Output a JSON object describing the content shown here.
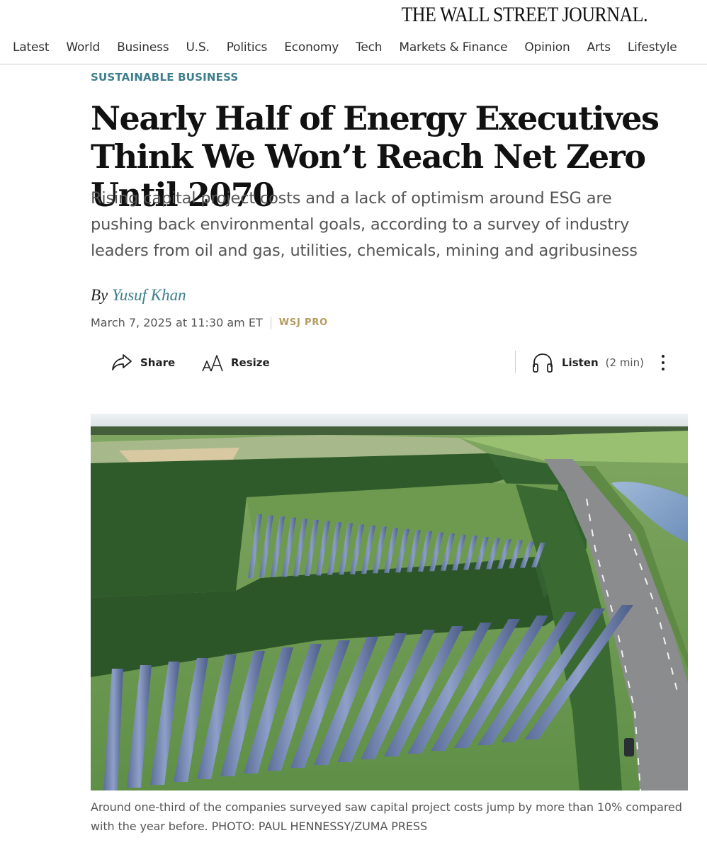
{
  "masthead": {
    "logo": "THE WALL STREET JOURNAL."
  },
  "nav": {
    "items": [
      "Latest",
      "World",
      "Business",
      "U.S.",
      "Politics",
      "Economy",
      "Tech",
      "Markets & Finance",
      "Opinion",
      "Arts",
      "Lifestyle"
    ]
  },
  "article": {
    "kicker": "SUSTAINABLE BUSINESS",
    "headline": "Nearly Half of Energy Executives Think We Won’t Reach Net Zero Until 2070",
    "dek": "Rising capital project costs and a lack of optimism around ESG are pushing back environmental goals, according to a survey of industry leaders from oil and gas, utilities, chemicals, mining and agribusiness",
    "byline_prefix": "By",
    "author": "Yusuf Khan",
    "date": "March 7, 2025 at 11:30 am ET",
    "section_tag": "WSJ PRO"
  },
  "toolbar": {
    "share_label": "Share",
    "resize_label": "Resize",
    "listen_label": "Listen",
    "listen_duration": "(2 min)"
  },
  "image": {
    "alt": "Aerial view of solar panel arrays beside a highway",
    "caption": "Around one-third of the companies surveyed saw capital project costs jump by more than 10% compared with the year before. PHOTO: PAUL HENNESSY/ZUMA PRESS"
  },
  "colors": {
    "accent_teal": "#3d7e8c",
    "pro_gold": "#b49a5c",
    "text_dark": "#111111",
    "text_muted": "#555555"
  }
}
